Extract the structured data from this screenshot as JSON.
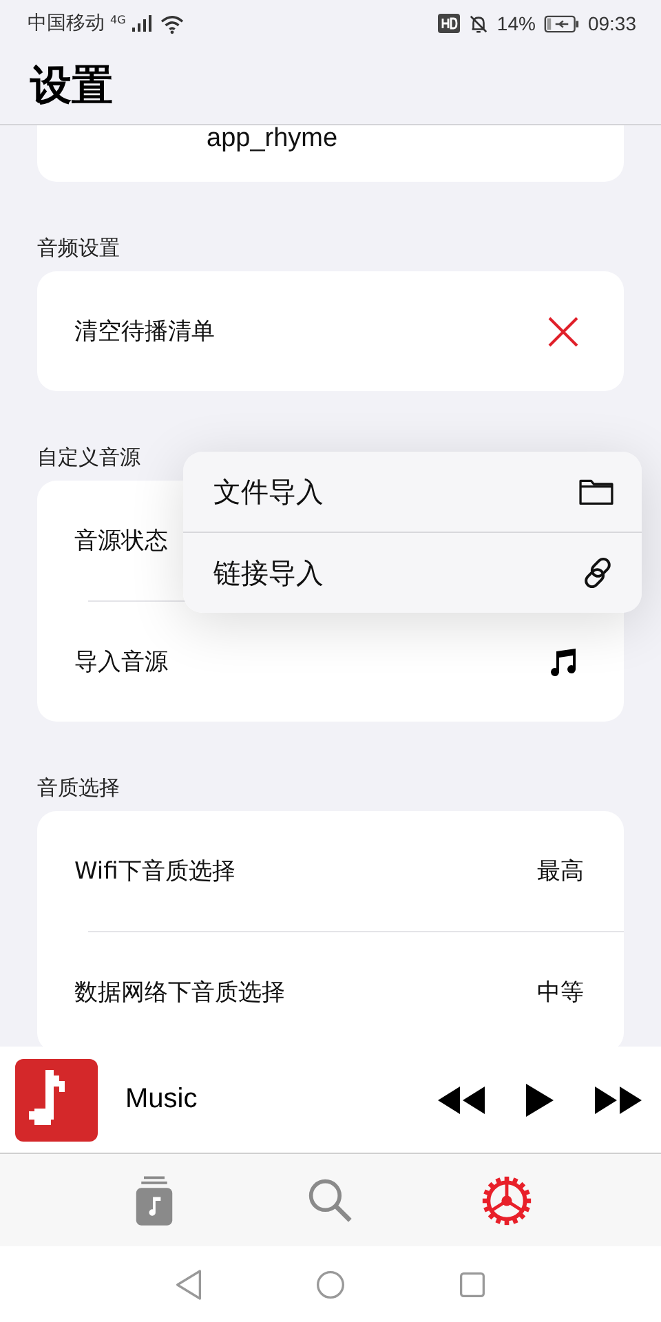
{
  "status_bar": {
    "carrier": "中国移动",
    "network": "4G",
    "battery": "14%",
    "time": "09:33"
  },
  "header": {
    "title": "设置"
  },
  "top_card": {
    "value": "app_rhyme"
  },
  "sections": [
    {
      "title": "音频设置",
      "rows": [
        {
          "label": "清空待播清单",
          "kind": "clear"
        }
      ]
    },
    {
      "title": "自定义音源",
      "rows": [
        {
          "label": "音源状态",
          "kind": "plain"
        },
        {
          "label": "导入音源",
          "kind": "music"
        }
      ]
    },
    {
      "title": "音质选择",
      "rows": [
        {
          "label": "Wifi下音质选择",
          "kind": "value",
          "value": "最高"
        },
        {
          "label": "数据网络下音质选择",
          "kind": "value",
          "value": "中等"
        }
      ]
    }
  ],
  "popup_menu": [
    {
      "label": "文件导入",
      "kind": "folder"
    },
    {
      "label": "链接导入",
      "kind": "link"
    }
  ],
  "player": {
    "title": "Music",
    "playing": false
  },
  "tab_bar": [
    {
      "kind": "library",
      "selected": false
    },
    {
      "kind": "search",
      "selected": false
    },
    {
      "kind": "settings",
      "selected": true
    }
  ]
}
